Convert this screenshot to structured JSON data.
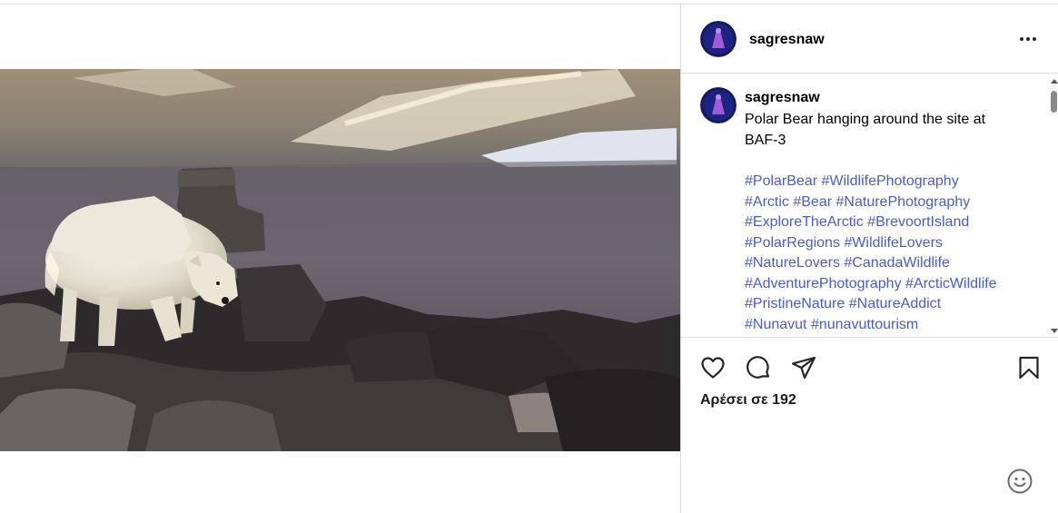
{
  "post": {
    "author": "sagresnaw",
    "caption_lines": [
      "Polar Bear hanging around the site at",
      "BAF-3"
    ],
    "hashtag_lines": [
      [
        "#PolarBear",
        "#WildlifePhotography"
      ],
      [
        "#Arctic",
        "#Bear",
        "#NaturePhotography"
      ],
      [
        "#ExploreTheArctic",
        "#BrevoortIsland"
      ],
      [
        "#PolarRegions",
        "#WildlifeLovers"
      ],
      [
        "#NatureLovers",
        "#CanadaWildlife"
      ],
      [
        "#AdventurePhotography",
        "#ArcticWildlife"
      ],
      [
        "#PristineNature",
        "#NatureAddict"
      ],
      [
        "#Nunavut",
        "#nunavuttourism"
      ]
    ],
    "likes_text": "Αρέσει σε 192"
  },
  "icons": {
    "more": "more-options-icon",
    "like": "heart-icon",
    "comment": "comment-icon",
    "share": "paper-plane-icon",
    "save": "bookmark-icon",
    "emoji": "emoji-smiley-icon"
  },
  "colors": {
    "hashtag": "#4a5cc9",
    "border": "#dbdbdb",
    "text": "#000000"
  }
}
